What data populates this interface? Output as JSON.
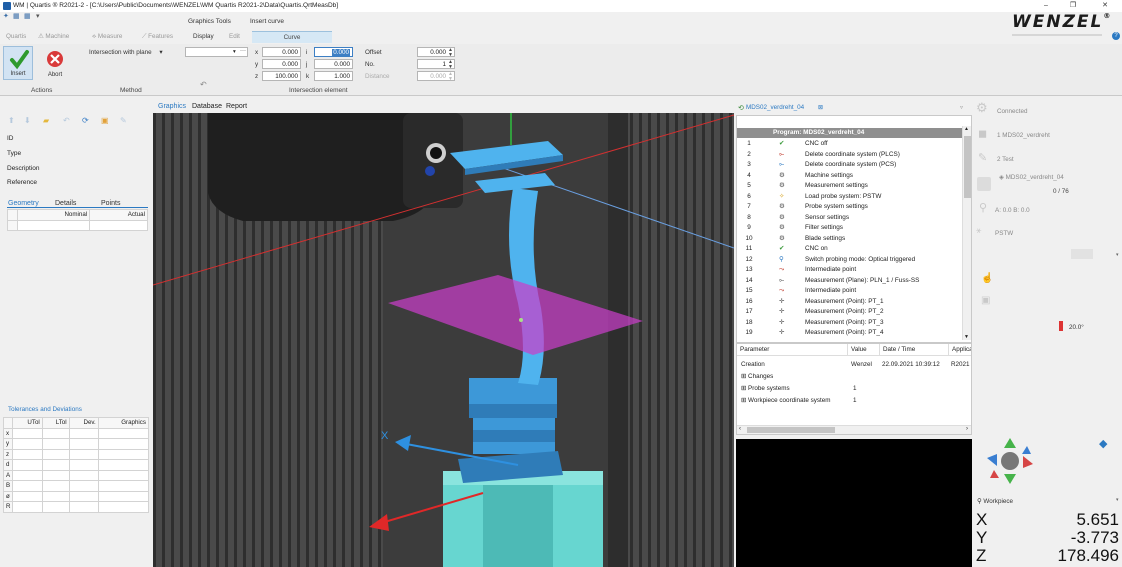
{
  "window": {
    "title": "WM | Quartis ® R2021-2 - [C:\\Users\\Public\\Documents\\WENZEL\\WM Quartis R2021-2\\Data\\Quartis.QrtMeasDb]",
    "minimize": "–",
    "maximize": "❐",
    "close": "✕"
  },
  "ribbon": {
    "context_headers": [
      "Graphics Tools",
      "Insert curve"
    ],
    "tabs": [
      "Quartis",
      "Machine",
      "Measure",
      "Features",
      "Display",
      "Edit",
      "Curve"
    ],
    "insert_label": "Insert",
    "abort_label": "Abort",
    "method_value": "Intersection with plane",
    "ellipsis": "···",
    "axes": {
      "x_label": "x",
      "y_label": "y",
      "z_label": "z",
      "i_label": "i",
      "j_label": "j",
      "k_label": "k",
      "x": "0.000",
      "y": "0.000",
      "z": "100.000",
      "i": "0.000",
      "j": "0.000",
      "k": "1.000"
    },
    "offset_label": "Offset",
    "offset_value": "0.000",
    "no_label": "No.",
    "no_value": "1",
    "distance_label": "Distance",
    "distance_value": "0.000",
    "groups": [
      "Actions",
      "Method",
      "Intersection element"
    ]
  },
  "brand": {
    "logo": "WENZEL",
    "help": "?"
  },
  "left_panel": {
    "fields": [
      "ID",
      "Type",
      "Description",
      "Reference"
    ],
    "subtabs": [
      "Geometry",
      "Details",
      "Points"
    ],
    "geometry_headers": [
      "Nominal",
      "Actual"
    ],
    "tolerances_title": "Tolerances and Deviations",
    "tol_headers": [
      "UTol",
      "LTol",
      "Dev.",
      "Graphics"
    ],
    "tol_rows": [
      "x",
      "y",
      "z",
      "d",
      "A",
      "B",
      "ø",
      "R"
    ]
  },
  "view_tabs": [
    "Graphics",
    "Database",
    "Report"
  ],
  "viewport": {
    "axis_label": "X"
  },
  "program": {
    "tab_title": "MDS02_verdreht_04",
    "header": "Program: MDS02_verdreht_04",
    "rows": [
      {
        "n": "1",
        "text": "CNC off"
      },
      {
        "n": "2",
        "text": "Delete coordinate system (PLCS)"
      },
      {
        "n": "3",
        "text": "Delete coordinate system (PCS)"
      },
      {
        "n": "4",
        "text": "Machine settings"
      },
      {
        "n": "5",
        "text": "Measurement settings"
      },
      {
        "n": "6",
        "text": "Load probe system: PSTW"
      },
      {
        "n": "7",
        "text": "Probe system settings"
      },
      {
        "n": "8",
        "text": "Sensor settings"
      },
      {
        "n": "9",
        "text": "Filter settings"
      },
      {
        "n": "10",
        "text": "Blade settings"
      },
      {
        "n": "11",
        "text": "CNC on"
      },
      {
        "n": "12",
        "text": "Switch probing mode: Optical triggered"
      },
      {
        "n": "13",
        "text": "Intermediate point"
      },
      {
        "n": "14",
        "text": "Measurement (Plane): PLN_1 / Fuss-SS"
      },
      {
        "n": "15",
        "text": "Intermediate point"
      },
      {
        "n": "16",
        "text": "Measurement (Point): PT_1"
      },
      {
        "n": "17",
        "text": "Measurement (Point): PT_2"
      },
      {
        "n": "18",
        "text": "Measurement (Point): PT_3"
      },
      {
        "n": "19",
        "text": "Measurement (Point): PT_4"
      }
    ]
  },
  "parameters": {
    "headers": [
      "Parameter",
      "Value",
      "Date / Time",
      "Applica"
    ],
    "creation": {
      "name": "Creation",
      "value": "Wenzel",
      "date": "22.09.2021 10:39:12",
      "app": "R2021"
    },
    "groups": [
      {
        "name": "Changes",
        "value": ""
      },
      {
        "name": "Probe systems",
        "value": "1"
      },
      {
        "name": "Workpiece coordinate system",
        "value": "1"
      }
    ]
  },
  "right_panel": {
    "connected": "Connected",
    "item1": "1 MDS02_verdreht",
    "item2": "2 Test",
    "item3": "MDS02_verdreht_04",
    "progress": "0 / 76",
    "angles": "A: 0.0 B: 0.0",
    "probe": "PSTW",
    "temperature": "20.0°",
    "workpiece": "Workpiece",
    "coords": [
      {
        "axis": "X",
        "value": "5.651"
      },
      {
        "axis": "Y",
        "value": "-3.773"
      },
      {
        "axis": "Z",
        "value": "178.496"
      }
    ]
  }
}
